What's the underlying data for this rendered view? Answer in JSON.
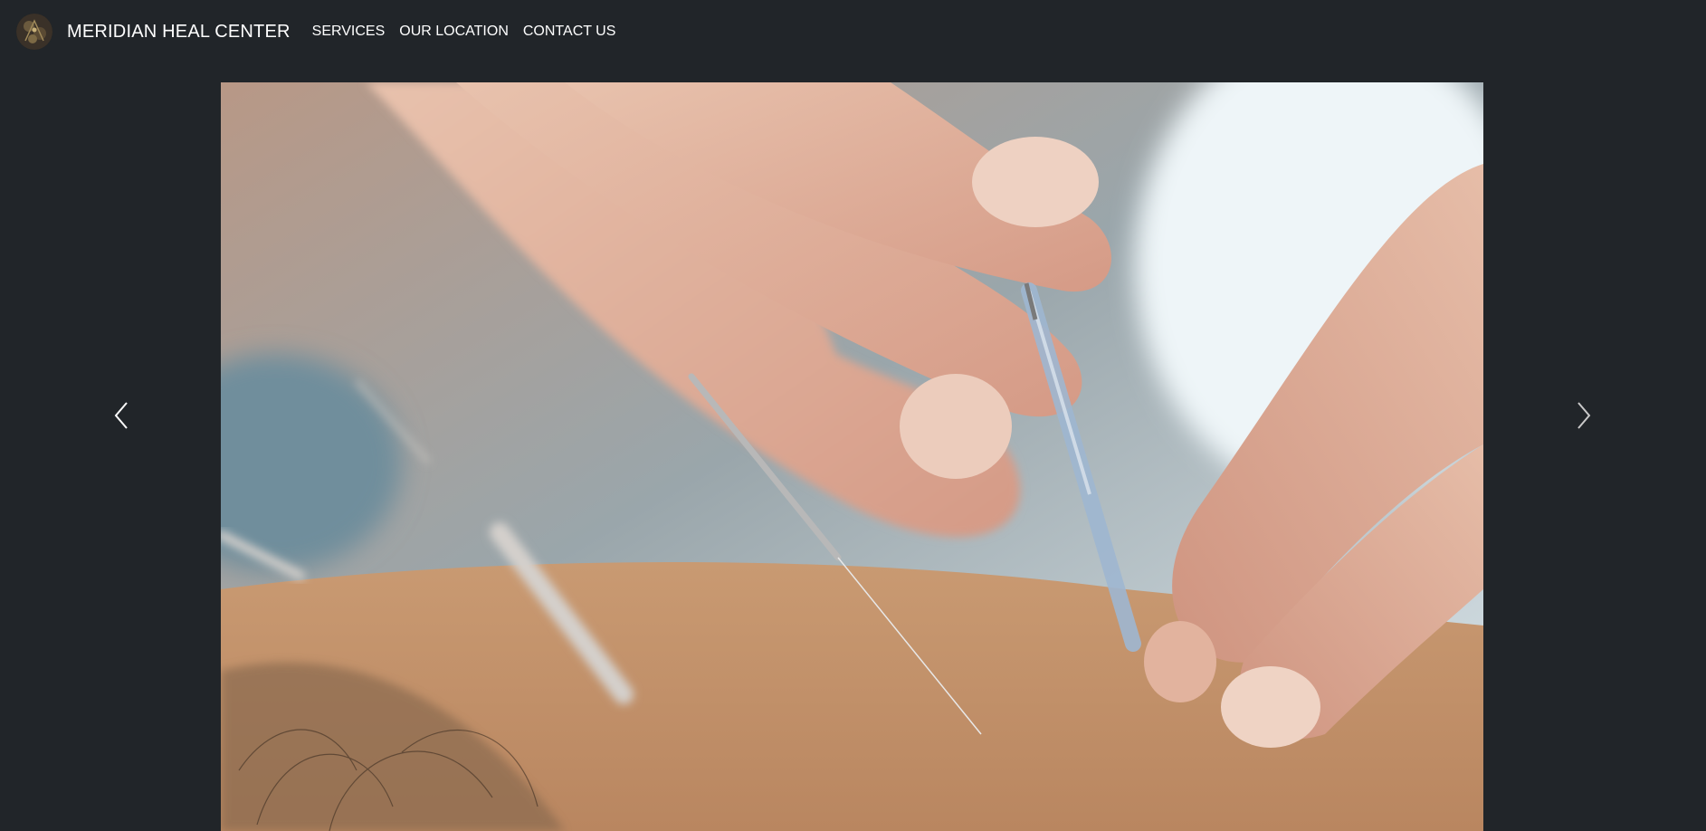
{
  "navbar": {
    "brand": "MERIDIAN HEAL CENTER",
    "logo_icon": "meridian-logo-icon",
    "links": [
      {
        "label": "SERVICES"
      },
      {
        "label": "OUR LOCATION"
      },
      {
        "label": "CONTACT US"
      }
    ]
  },
  "carousel": {
    "prev_icon": "chevron-left-icon",
    "next_icon": "chevron-right-icon",
    "slide_image": "acupuncture-needle-photo"
  },
  "colors": {
    "background": "#212529",
    "text": "#ffffff",
    "skin": "#c9926a"
  }
}
